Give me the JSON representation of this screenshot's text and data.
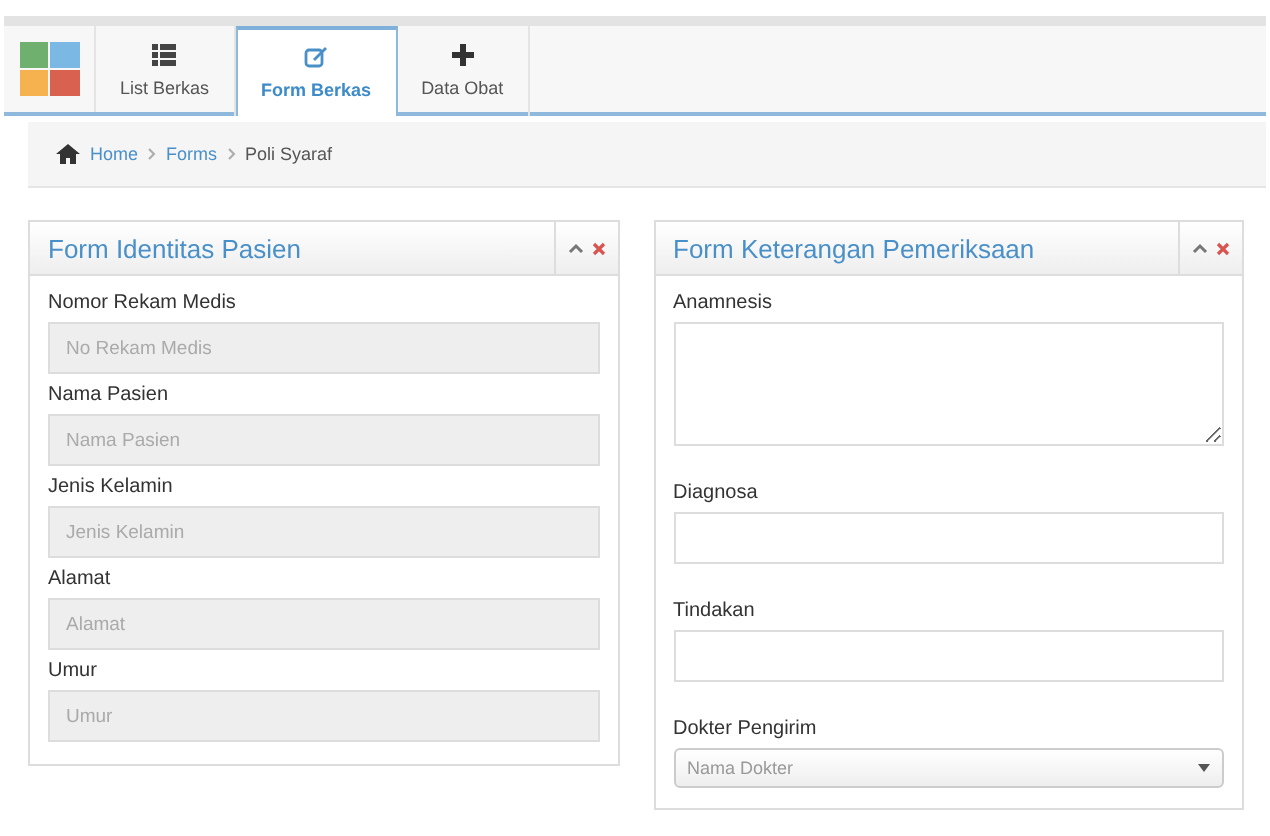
{
  "nav": {
    "tabs": [
      {
        "kind": "list",
        "label": "List Berkas",
        "selected": false
      },
      {
        "kind": "edit",
        "label": "Form Berkas",
        "selected": true
      },
      {
        "kind": "plus",
        "label": "Data Obat",
        "selected": false
      }
    ]
  },
  "breadcrumb": [
    {
      "kind": "home",
      "label": "Home"
    },
    {
      "kind": "link",
      "label": "Forms"
    },
    {
      "kind": "current",
      "label": "Poli Syaraf"
    }
  ],
  "panels": [
    {
      "title": "Form Identitas Pasien",
      "fields": [
        {
          "label": "Nomor Rekam Medis",
          "kind": "input",
          "placeholder": "No Rekam Medis",
          "disabled": true
        },
        {
          "label": "Nama Pasien",
          "kind": "input",
          "placeholder": "Nama Pasien",
          "disabled": true
        },
        {
          "label": "Jenis Kelamin",
          "kind": "input",
          "placeholder": "Jenis Kelamin",
          "disabled": true
        },
        {
          "label": "Alamat",
          "kind": "input",
          "placeholder": "Alamat",
          "disabled": true
        },
        {
          "label": "Umur",
          "kind": "input",
          "placeholder": "Umur",
          "disabled": true
        }
      ]
    },
    {
      "title": "Form Keterangan Pemeriksaan",
      "fields": [
        {
          "label": "Anamnesis",
          "kind": "textarea",
          "disabled": false
        },
        {
          "label": "Diagnosa",
          "kind": "input",
          "disabled": false
        },
        {
          "label": "Tindakan",
          "kind": "input",
          "disabled": false
        },
        {
          "label": "Dokter Pengirim",
          "kind": "select",
          "placeholder": "Nama Dokter",
          "disabled": false
        }
      ]
    }
  ]
}
